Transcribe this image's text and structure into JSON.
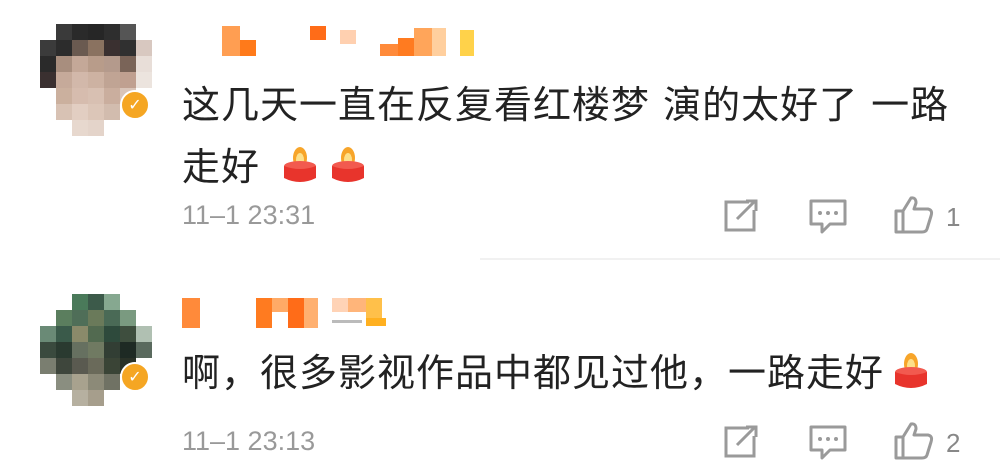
{
  "comments": [
    {
      "text_line1": "这几天一直在反复看红楼梦 演的太好了 一路",
      "text_line2": "走好",
      "time": "11–1 23:31",
      "likes": "1"
    },
    {
      "text_line1": "啊，很多影视作品中都见过他，一路走好",
      "time": "11–1 23:13",
      "likes": "2"
    }
  ],
  "icons": {
    "verified": "verified-badge-icon",
    "candle": "candle-emoji-icon",
    "share": "share-icon",
    "reply": "comment-icon",
    "like": "thumbs-up-icon"
  },
  "colors": {
    "verified": "#f5a623",
    "candle_red": "#e8342c",
    "flame": "#f7a52a",
    "muted": "#999999"
  }
}
